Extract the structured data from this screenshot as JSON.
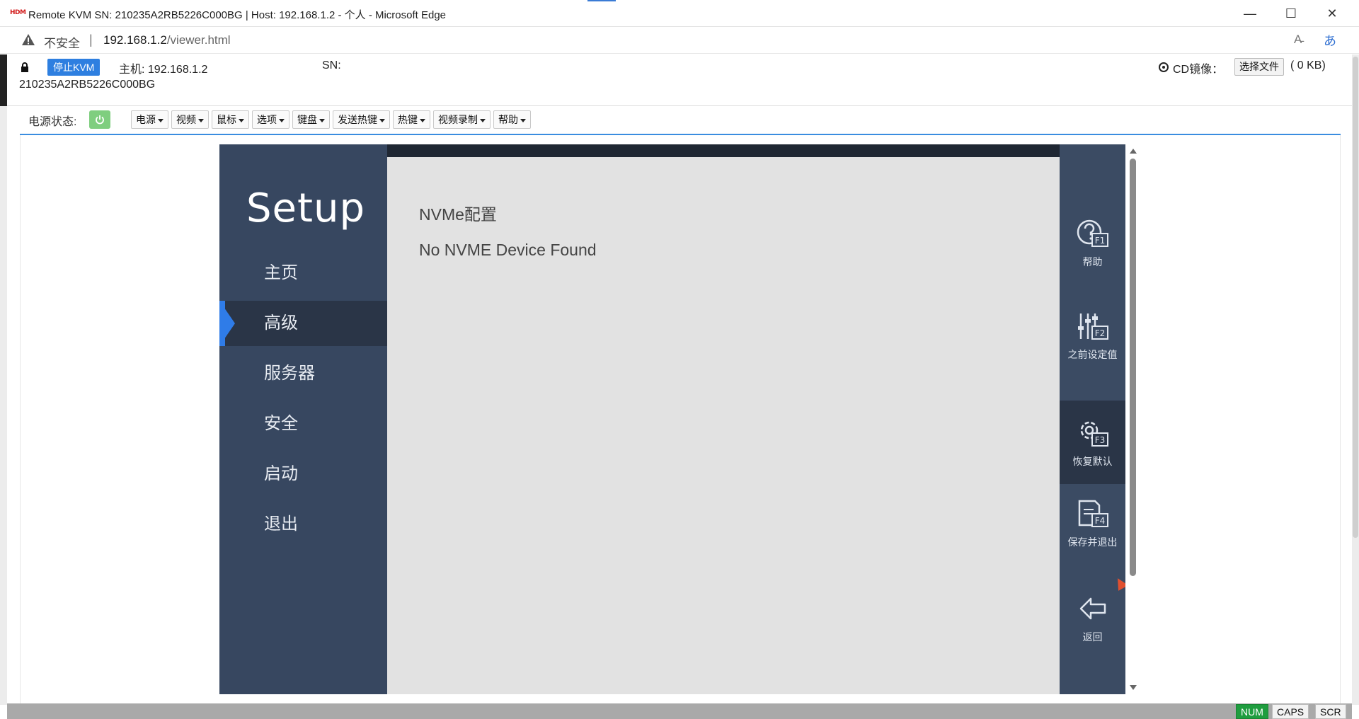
{
  "window": {
    "app_icon_text": "HDM",
    "title": "Remote KVM SN: 210235A2RB5226C000BG | Host: 192.168.1.2 - 个人 - Microsoft Edge",
    "minimize": "—",
    "maximize": "☐",
    "close": "✕"
  },
  "addressbar": {
    "security_label": "不安全",
    "separator": "|",
    "url_host": "192.168.1.2",
    "url_path": "/viewer.html",
    "read_aloud": "A̵",
    "translate": "あ"
  },
  "kvm_header": {
    "stop_button": "停止KVM",
    "host_label": "主机:  192.168.1.2",
    "sn_label": "SN:",
    "sn_value": "210235A2RB5226C000BG",
    "cd_label": "CD镜像：",
    "choose_file_button": "选择文件",
    "cd_size": "( 0 KB)"
  },
  "toolbar": {
    "power_status_label": "电源状态:",
    "menus": [
      "电源",
      "视频",
      "鼠标",
      "选项",
      "键盘",
      "发送热键",
      "热键",
      "视频录制",
      "帮助"
    ]
  },
  "bios": {
    "title": "Setup",
    "nav": [
      "主页",
      "高级",
      "服务器",
      "安全",
      "启动",
      "退出"
    ],
    "active_nav": "高级",
    "section_title": "NVMe配置",
    "message": "No NVME Device Found",
    "function_keys": [
      {
        "key": "F1",
        "label": "帮助",
        "icon": "help-icon"
      },
      {
        "key": "F2",
        "label": "之前设定值",
        "icon": "sliders-icon"
      },
      {
        "key": "F3",
        "label": "恢复默认",
        "icon": "gear-icon"
      },
      {
        "key": "F4",
        "label": "保存并退出",
        "icon": "save-icon"
      },
      {
        "key": "",
        "label": "返回",
        "icon": "back-arrow-icon"
      }
    ]
  },
  "statusbar": {
    "num": "NUM",
    "caps": "CAPS",
    "scr": "SCR"
  },
  "colors": {
    "accent": "#2e7fe0",
    "bios_sidebar": "#374760",
    "bios_active": "#2a3547",
    "bios_panel": "#e2e2e2",
    "num_on": "#1f9d3f",
    "power_on": "#7fce7f"
  }
}
